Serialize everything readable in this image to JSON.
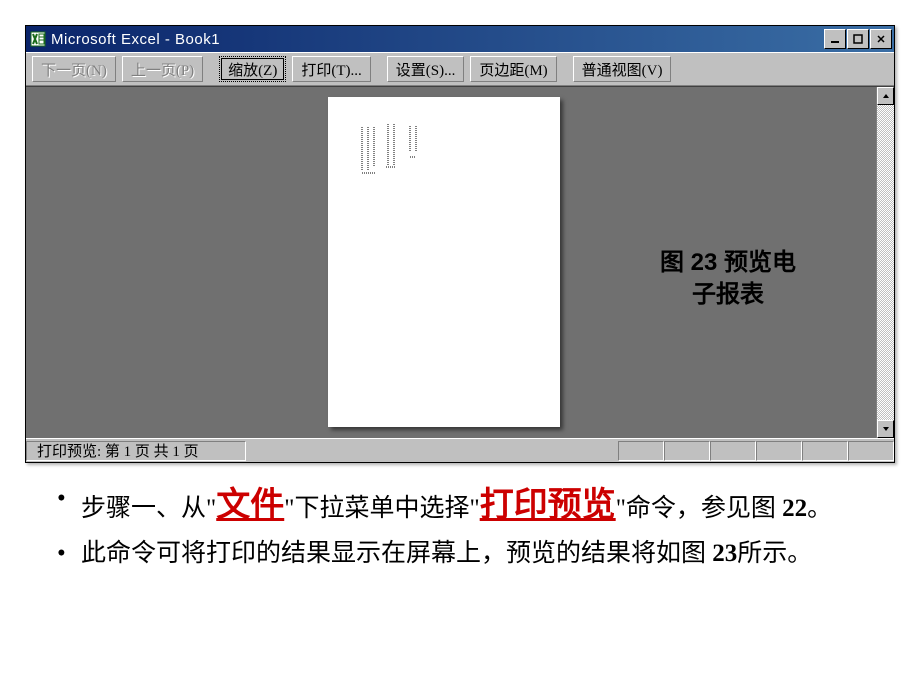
{
  "window": {
    "title": "Microsoft Excel - Book1"
  },
  "toolbar": {
    "prev_page": "下一页(N)",
    "next_page": "上一页(P)",
    "zoom": "缩放(Z)",
    "print": "打印(T)...",
    "setup": "设置(S)...",
    "margins": "页边距(M)",
    "normal_view": "普通视图(V)"
  },
  "figure_caption": {
    "line1": "图 23 预览电",
    "line2": "子报表"
  },
  "status": {
    "text": "打印预览: 第 1 页  共 1 页"
  },
  "instructions": {
    "step1_a": "步骤一、从",
    "step1_q1": "\"",
    "step1_emph1": "文件",
    "step1_q2": "\"",
    "step1_b": "下拉菜单中选择",
    "step1_q3": "\"",
    "step1_emph2": "打印预览",
    "step1_q4": "\"",
    "step1_c": "命令，参见图",
    "step1_fig": " 22",
    "step1_d": "。",
    "step2_a": "此命令可将打印的结果显示在屏幕上，预览的结果将如图",
    "step2_fig": " 23",
    "step2_b": "所示。"
  }
}
